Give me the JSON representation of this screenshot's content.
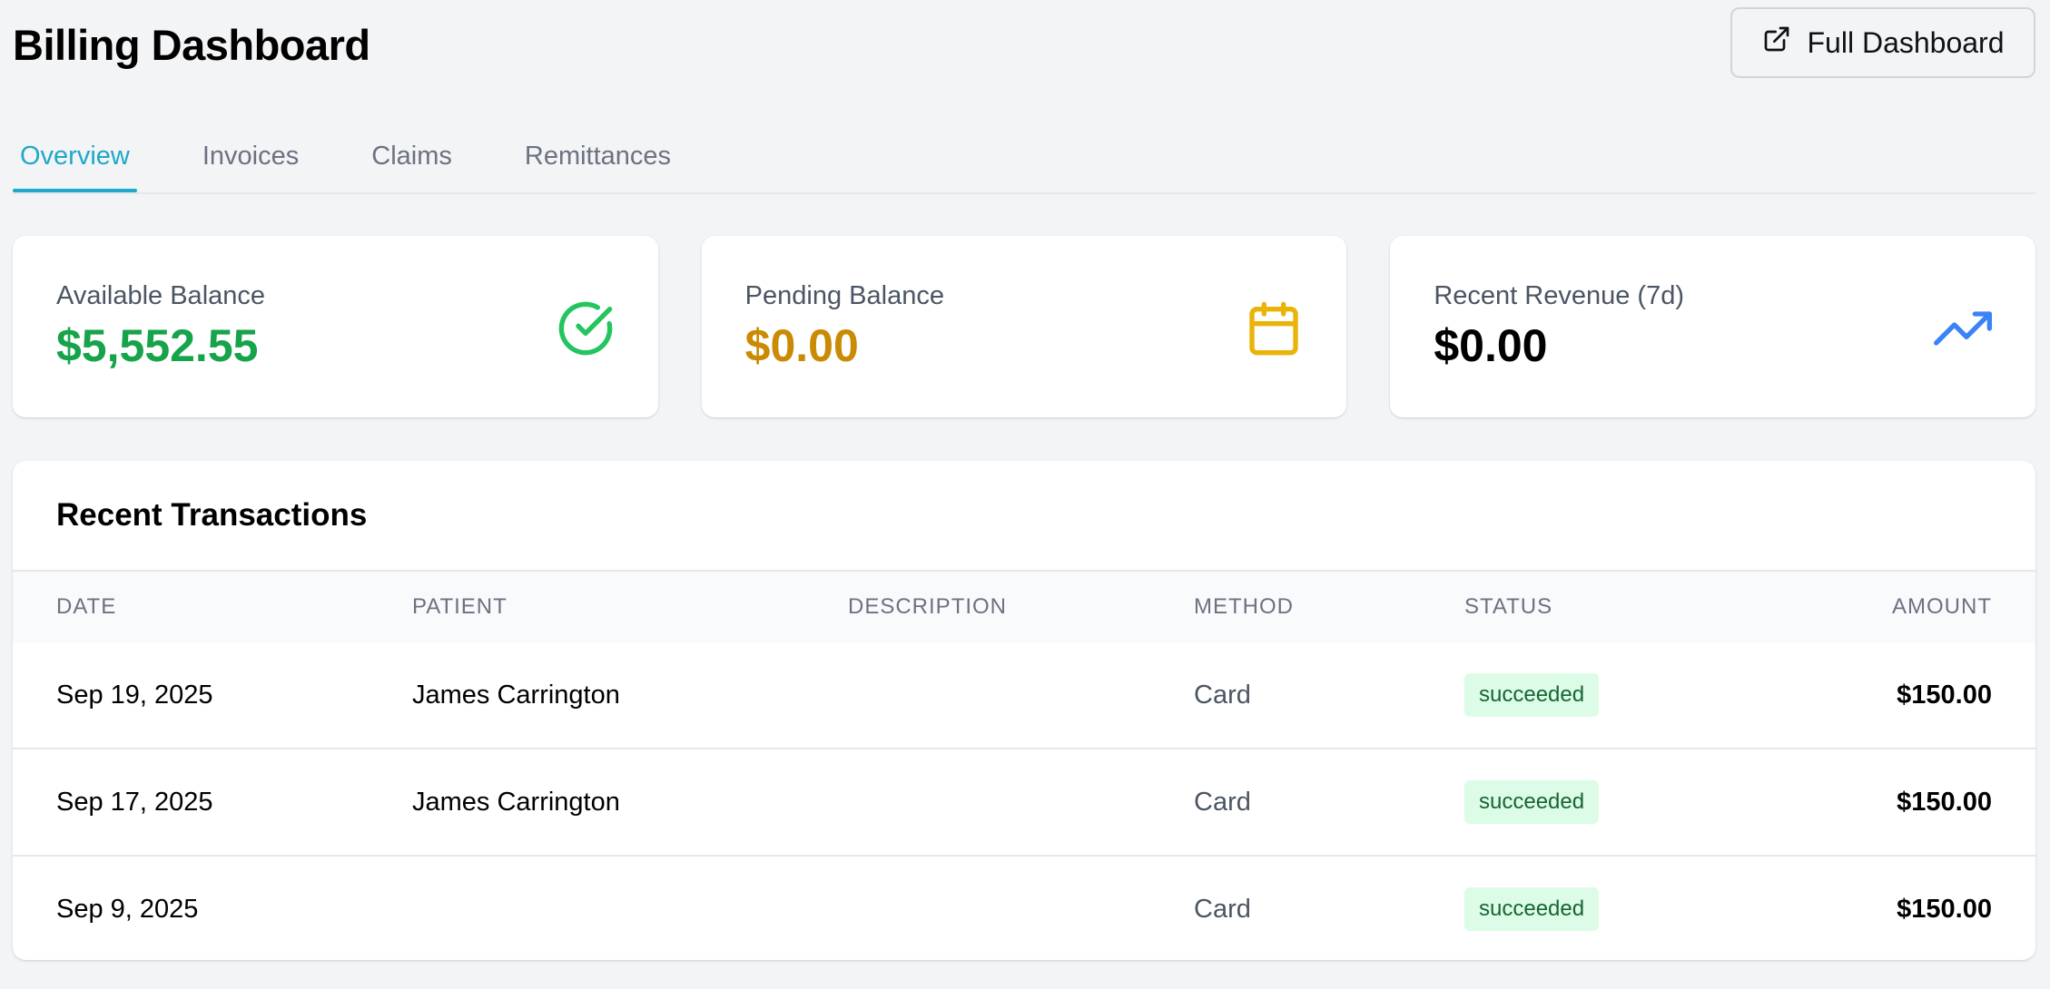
{
  "header": {
    "title": "Billing Dashboard",
    "full_dashboard_label": "Full Dashboard"
  },
  "tabs": [
    {
      "label": "Overview",
      "active": true
    },
    {
      "label": "Invoices",
      "active": false
    },
    {
      "label": "Claims",
      "active": false
    },
    {
      "label": "Remittances",
      "active": false
    }
  ],
  "cards": [
    {
      "label": "Available Balance",
      "value": "$5,552.55",
      "value_color": "#16a34a",
      "icon": "check-circle-icon",
      "icon_color": "#22c55e"
    },
    {
      "label": "Pending Balance",
      "value": "$0.00",
      "value_color": "#ca8a04",
      "icon": "calendar-icon",
      "icon_color": "#eab308"
    },
    {
      "label": "Recent Revenue (7d)",
      "value": "$0.00",
      "value_color": "#000000",
      "icon": "trending-up-icon",
      "icon_color": "#3b82f6"
    }
  ],
  "transactions": {
    "title": "Recent Transactions",
    "columns": [
      "Date",
      "Patient",
      "Description",
      "Method",
      "Status",
      "Amount"
    ],
    "rows": [
      {
        "date": "Sep 19, 2025",
        "patient": "James Carrington",
        "description": "",
        "method": "Card",
        "status": "succeeded",
        "amount": "$150.00"
      },
      {
        "date": "Sep 17, 2025",
        "patient": "James Carrington",
        "description": "",
        "method": "Card",
        "status": "succeeded",
        "amount": "$150.00"
      },
      {
        "date": "Sep 9, 2025",
        "patient": "",
        "description": "",
        "method": "Card",
        "status": "succeeded",
        "amount": "$150.00"
      }
    ]
  },
  "colors": {
    "accent": "#1fa8c9",
    "success_badge_bg": "#dcfce7",
    "success_badge_text": "#166534"
  }
}
